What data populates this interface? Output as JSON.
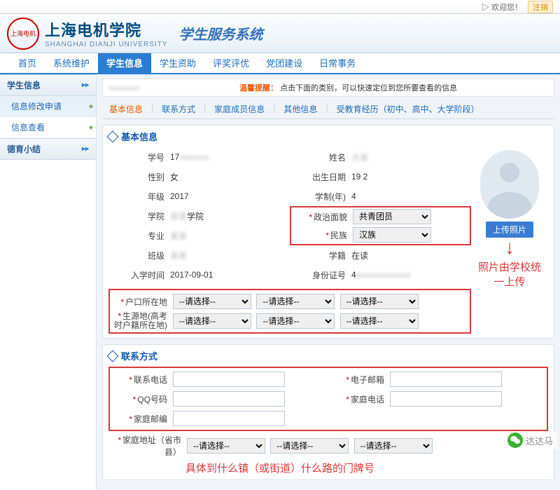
{
  "topbar": {
    "welcome": "▷ 欢迎您！",
    "logout": "注销"
  },
  "header": {
    "cn": "上海电机学院",
    "en": "SHANGHAI DIANJI UNIVERSITY",
    "system": "学生服务系统"
  },
  "nav": {
    "home": "首页",
    "sys": "系统维护",
    "stu": "学生信息",
    "aid": "学生资助",
    "eval": "评奖评优",
    "party": "党团建设",
    "daily": "日常事务"
  },
  "side": {
    "g1": "学生信息",
    "i1": "信息修改申请",
    "i2": "信息查看",
    "g2": "德育小结"
  },
  "hint": {
    "label": "温馨提醒：",
    "text": "点击下面的类别，可以快速定位到您所要查看的信息"
  },
  "tabs": {
    "t1": "基本信息",
    "t2": "联系方式",
    "t3": "家庭成员信息",
    "t4": "其他信息",
    "t5": "受教育经历（初中、高中、大学阶段）"
  },
  "sec1": {
    "title": "基本信息"
  },
  "sec2": {
    "title": "联系方式"
  },
  "labels": {
    "sno": "学号",
    "name": "姓名",
    "gender": "性别",
    "birth": "出生日期",
    "grade": "年级",
    "years": "学制(年)",
    "college": "学院",
    "pol": "政治面貌",
    "major": "专业",
    "ethnic": "民族",
    "class": "班级",
    "status": "学籍",
    "enroll": "入学时间",
    "idno": "身份证号",
    "hukou": "户口所在地",
    "origin1": "生源地(高考",
    "origin2": "时户籍所在地)",
    "phone": "联系电话",
    "email": "电子邮箱",
    "qq": "QQ号码",
    "homephone": "家庭电话",
    "homepost": "家庭邮编",
    "homeaddr": "家庭地址（省市县）"
  },
  "values": {
    "sno": "17",
    "name_blur": "方某",
    "gender": "女",
    "birth_blur": "19      2",
    "grade": "2017",
    "years": "4",
    "college_suffix": "学院",
    "pol": "共青团员",
    "ethnic": "汉族",
    "status": "在读",
    "enroll": "2017-09-01",
    "idno_prefix": "4",
    "select_ph": "--请选择--"
  },
  "photo": {
    "btn": "上传照片"
  },
  "annot": {
    "photo_note": "照片由学校统一上传",
    "addr_note": "具体到什么镇（或街道）什么路的门牌号"
  },
  "wechat": "达达马"
}
